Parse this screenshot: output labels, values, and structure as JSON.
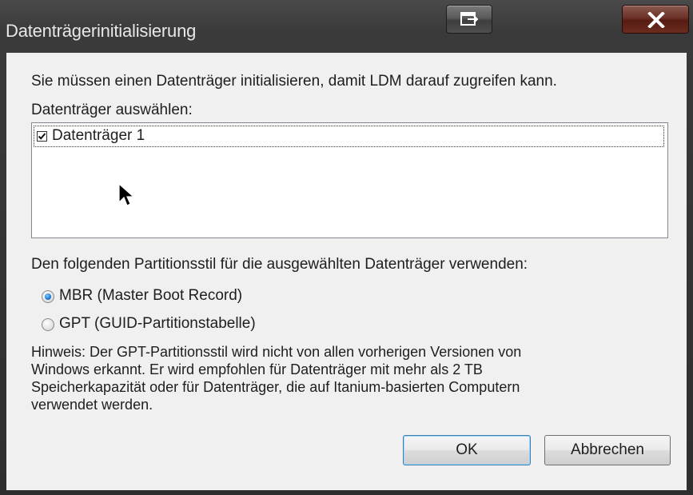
{
  "window": {
    "title": "Datenträgerinitialisierung",
    "restore_icon": "restore-window-icon",
    "close_icon": "close-icon"
  },
  "intro_text": "Sie müssen einen Datenträger initialisieren, damit LDM darauf zugreifen kann.",
  "select_label": "Datenträger auswählen:",
  "disks": [
    {
      "label": "Datenträger 1",
      "checked": true
    }
  ],
  "partition_style_label": "Den folgenden Partitionsstil für die ausgewählten Datenträger verwenden:",
  "partition_options": [
    {
      "label": "MBR (Master Boot Record)",
      "selected": true
    },
    {
      "label": "GPT (GUID-Partitionstabelle)",
      "selected": false
    }
  ],
  "note_lines": [
    "Hinweis: Der GPT-Partitionsstil wird nicht von allen vorherigen Versionen von",
    "Windows erkannt. Er wird empfohlen für Datenträger mit mehr als 2 TB",
    "Speicherkapazität oder für Datenträger, die auf Itanium-basierten Computern",
    "verwendet werden."
  ],
  "buttons": {
    "ok": "OK",
    "cancel": "Abbrechen"
  },
  "colors": {
    "radio_selected": "#1f7fd6",
    "close_button": "#6b3128",
    "dialog_background": "#f0f0f0"
  }
}
